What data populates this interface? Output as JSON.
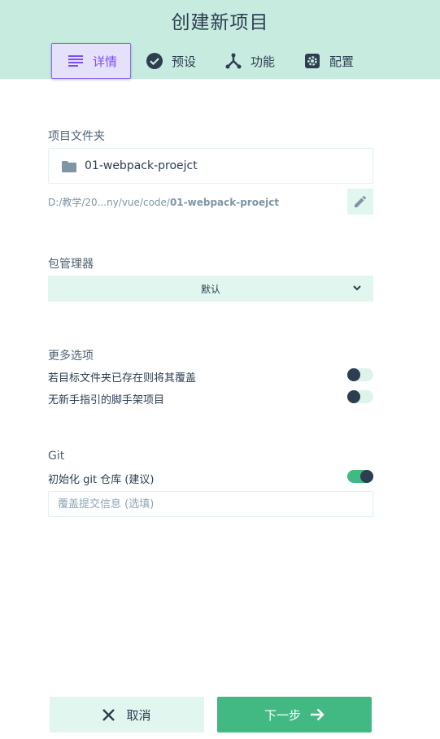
{
  "header": {
    "title": "创建新项目",
    "tabs": [
      {
        "label": "详情",
        "icon": "details-list-icon",
        "active": true
      },
      {
        "label": "预设",
        "icon": "check-circle-icon",
        "active": false
      },
      {
        "label": "功能",
        "icon": "merge-type-icon",
        "active": false
      },
      {
        "label": "配置",
        "icon": "settings-icon",
        "active": false
      }
    ]
  },
  "project_folder": {
    "label": "项目文件夹",
    "value": "01-webpack-proejct",
    "path_prefix": "D:/教学/20...ny/vue/code/",
    "path_name": "01-webpack-proejct"
  },
  "package_manager": {
    "label": "包管理器",
    "selected": "默认"
  },
  "more_options": {
    "label": "更多选项",
    "items": [
      {
        "label": "若目标文件夹已存在则将其覆盖",
        "enabled": false
      },
      {
        "label": "无新手指引的脚手架项目",
        "enabled": false
      }
    ]
  },
  "git": {
    "label": "Git",
    "init_label": "初始化 git 仓库 (建议)",
    "init_enabled": true,
    "commit_placeholder": "覆盖提交信息 (选填)"
  },
  "footer": {
    "cancel_label": "取消",
    "next_label": "下一步"
  },
  "colors": {
    "header_bg": "#c8ebe0",
    "accent": "#42b983",
    "active_tab": "#7c4dff",
    "text": "#2c3e50"
  }
}
